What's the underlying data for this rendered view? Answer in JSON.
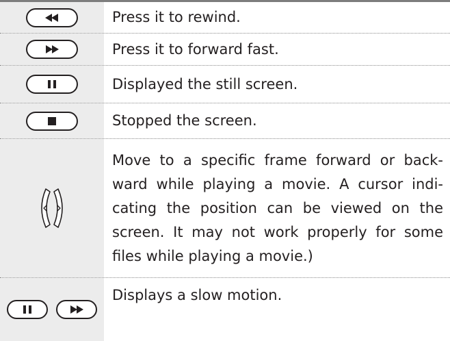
{
  "rows": [
    {
      "icon": "rewind-icon",
      "text": "Press it to rewind."
    },
    {
      "icon": "fast-forward-icon",
      "text": "Press it to forward fast."
    },
    {
      "icon": "pause-icon",
      "text": "Displayed the still screen."
    },
    {
      "icon": "stop-icon",
      "text": "Stopped the screen."
    },
    {
      "icon": "left-right-arrows-icon",
      "text": "Move to a specific frame forward or back-ward while playing a movie. A cursor indi-cating the position can be viewed on the screen. It may not work properly for some files while playing a movie.)"
    },
    {
      "icon": "pause-and-fast-forward-icons",
      "text": "Displays a slow motion."
    }
  ],
  "colors": {
    "icon_cell_bg": "#ececec",
    "top_rule": "#7d7d7d",
    "separator": "#8a8a8a",
    "text": "#231f20"
  }
}
